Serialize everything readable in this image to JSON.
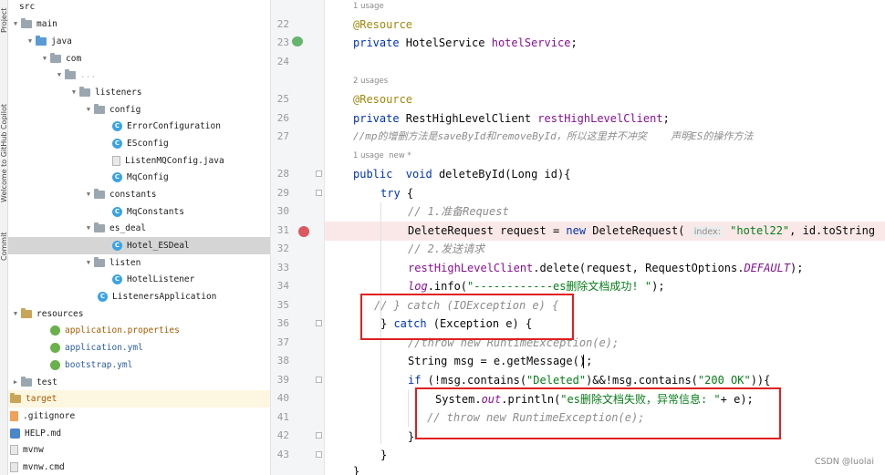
{
  "tool_strip": {
    "labels": [
      "Project",
      "Welcome to GitHub Copilot",
      "Commit"
    ]
  },
  "project_tree": {
    "rows": [
      {
        "label": "src"
      },
      {
        "label": "main"
      },
      {
        "label": "java"
      },
      {
        "label": "com"
      },
      {
        "label": "..."
      },
      {
        "label": "listeners"
      },
      {
        "label": "config"
      },
      {
        "label": "ErrorConfiguration"
      },
      {
        "label": "ESconfig"
      },
      {
        "label": "ListenMQConfig.java"
      },
      {
        "label": "MqConfig"
      },
      {
        "label": "constants"
      },
      {
        "label": "MqConstants"
      },
      {
        "label": "es_deal"
      },
      {
        "label": "Hotel_ESDeal"
      },
      {
        "label": "listen"
      },
      {
        "label": "HotelListener"
      },
      {
        "label": "ListenersApplication"
      },
      {
        "label": "resources"
      },
      {
        "label": "application.properties"
      },
      {
        "label": "application.yml"
      },
      {
        "label": "bootstrap.yml"
      },
      {
        "label": "test"
      },
      {
        "label": "target"
      },
      {
        "label": ".gitignore"
      },
      {
        "label": "HELP.md"
      },
      {
        "label": "mvnw"
      },
      {
        "label": "mvnw.cmd"
      }
    ]
  },
  "gutter": {
    "line_numbers": [
      "22",
      "23",
      "24",
      "25",
      "26",
      "27",
      "28",
      "29",
      "30",
      "31",
      "32",
      "33",
      "34",
      "35",
      "36",
      "37",
      "38",
      "39",
      "40",
      "41",
      "42",
      "43"
    ]
  },
  "editor": {
    "hint_1usage_top": "1 usage",
    "hint_2usages": "2 usages",
    "hint_1usage_new": "1 usage  new *",
    "param_hint": "index:",
    "lines": {
      "l22": "@Resource",
      "l23_kw": "private",
      "l23_rest": " HotelService ",
      "l23_field": "hotelService",
      "l23_end": ";",
      "l25": "@Resource",
      "l26_kw": "private",
      "l26_rest": " RestHighLevelClient ",
      "l26_field": "restHighLevelClient",
      "l26_end": ";",
      "l27": "//mp的增删方法是saveById和removeById，所以这里并不冲突    声明ES的操作方法",
      "l28_kw1": "public",
      "l28_kw2": "  void",
      "l28_rest": " deleteById(Long id){",
      "l29_kw": "try",
      "l29_rest": " {",
      "l30": "// 1.准备Request",
      "l31_a": "DeleteRequest request = ",
      "l31_kw": "new",
      "l31_b": " DeleteRequest(",
      "l31_str": "\"hotel22\"",
      "l31_c": ", id.toString",
      "l32": "// 2.发送请求",
      "l33_field": "restHighLevelClient",
      "l33_a": ".delete(request, RequestOptions.",
      "l33_const": "DEFAULT",
      "l33_b": ");",
      "l34_ital": "log",
      "l34_a": ".info(",
      "l34_str": "\"------------es删除文档成功! \"",
      "l34_b": ");",
      "l35": "// } catch (IOException e) {",
      "l36_a": "} ",
      "l36_kw": "catch",
      "l36_b": " (Exception e) {",
      "l37": "//throw new RuntimeException(e);",
      "l38": "String msg = e.getMessage();",
      "l39_kw": "if",
      "l39_a": " (!msg.contains(",
      "l39_str1": "\"Deleted\"",
      "l39_b": ")&&!msg.contains(",
      "l39_str2": "\"200 OK\"",
      "l39_c": ")){",
      "l40_a": "System.",
      "l40_out": "out",
      "l40_b": ".println(",
      "l40_str": "\"es删除文档失败，异常信息: \"",
      "l40_c": "+ e);",
      "l41": "// throw new RuntimeException(e);",
      "l42": "}",
      "l43": "}",
      "l44": "}"
    }
  },
  "watermark": "CSDN @luolai"
}
